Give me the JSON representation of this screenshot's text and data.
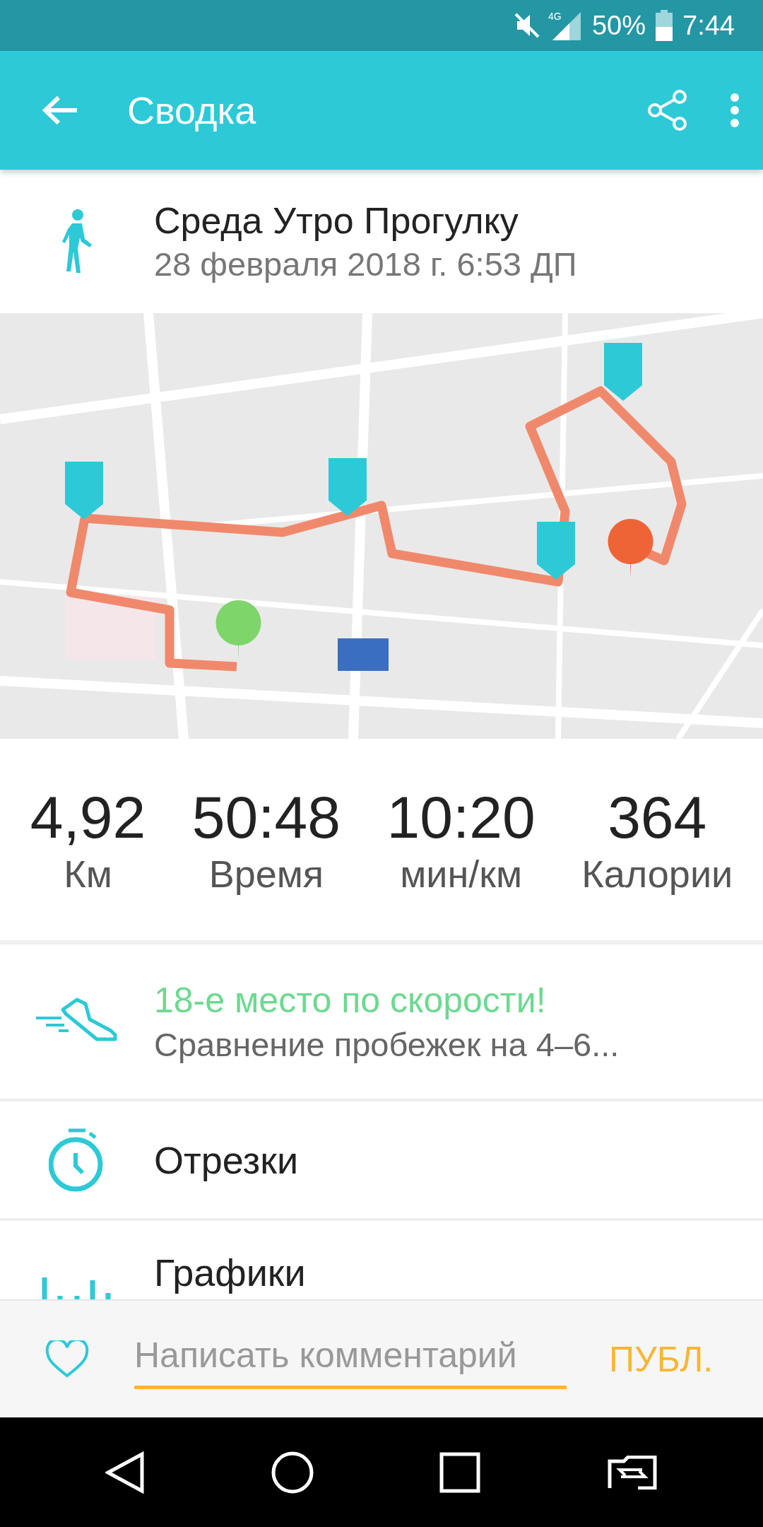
{
  "status_bar": {
    "network": "4G",
    "battery": "50%",
    "time": "7:44"
  },
  "app_bar": {
    "title": "Сводка"
  },
  "activity": {
    "title": "Среда Утро Прогулку",
    "date": "28 февраля 2018 г. 6:53 ДП"
  },
  "stats": [
    {
      "value": "4,92",
      "label": "Км"
    },
    {
      "value": "50:48",
      "label": "Время"
    },
    {
      "value": "10:20",
      "label": "мин/км"
    },
    {
      "value": "364",
      "label": "Калории"
    }
  ],
  "items": [
    {
      "kind": "achievement",
      "title": "18-е место по скорости!",
      "subtitle": "Сравнение пробежек на 4–6..."
    },
    {
      "kind": "splits",
      "title": "Отрезки"
    },
    {
      "kind": "charts",
      "title": "Графики"
    }
  ],
  "comment_bar": {
    "placeholder": "Написать комментарий",
    "button": "ПУБЛ."
  }
}
